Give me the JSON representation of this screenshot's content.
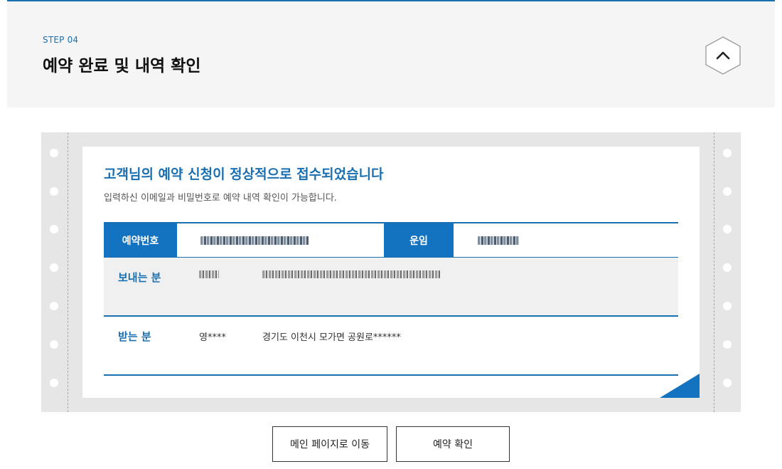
{
  "step": {
    "label": "STEP 04",
    "title": "예약 완료 및 내역 확인",
    "toggle_icon": "chevron-up-icon"
  },
  "message": {
    "title": "고객님의 예약 신청이 정상적으로 접수되었습니다",
    "subtitle": "입력하신 이메일과 비밀번호로 예약 내역 확인이 가능합니다."
  },
  "reservation": {
    "number_label": "예약번호",
    "number_value_masked": true,
    "fare_label": "운임",
    "fare_value_masked": true
  },
  "sender": {
    "label": "보내는 분",
    "name_masked": true,
    "address_masked": true
  },
  "receiver": {
    "label": "받는 분",
    "name": "영****",
    "address": "경기도 이천시 모가면 공원로******"
  },
  "buttons": {
    "main_page": "메인 페이지로 이동",
    "confirm": "예약 확인"
  },
  "colors": {
    "accent": "#1a6fb0",
    "header_bg": "#f5f5f5",
    "receipt_bg": "#e6e6e6"
  }
}
